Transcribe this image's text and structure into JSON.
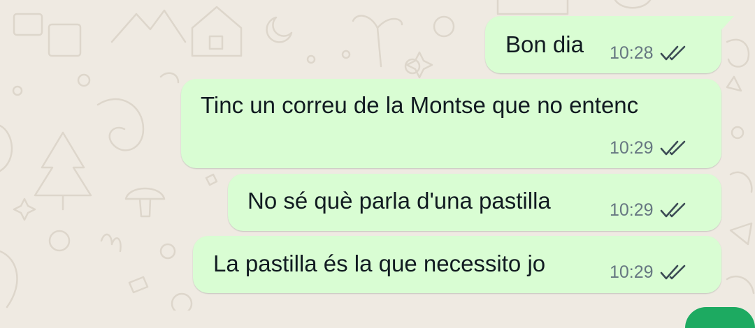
{
  "chat": {
    "messages": [
      {
        "text": "Bon dia",
        "time": "10:28",
        "status": "read"
      },
      {
        "text": "Tinc un correu de la Montse que no entenc",
        "time": "10:29",
        "status": "read"
      },
      {
        "text": "No sé què parla d'una pastilla",
        "time": "10:29",
        "status": "read"
      },
      {
        "text": "La pastilla és la que necessito jo",
        "time": "10:29",
        "status": "read"
      }
    ]
  },
  "icons": {
    "status": "double-check-icon"
  },
  "colors": {
    "background": "#efeae2",
    "outgoing_bubble": "#d9fdd3",
    "text": "#111b21",
    "meta_text": "#667781",
    "read_ticks": "#3b4a54",
    "fab": "#1daa61"
  }
}
